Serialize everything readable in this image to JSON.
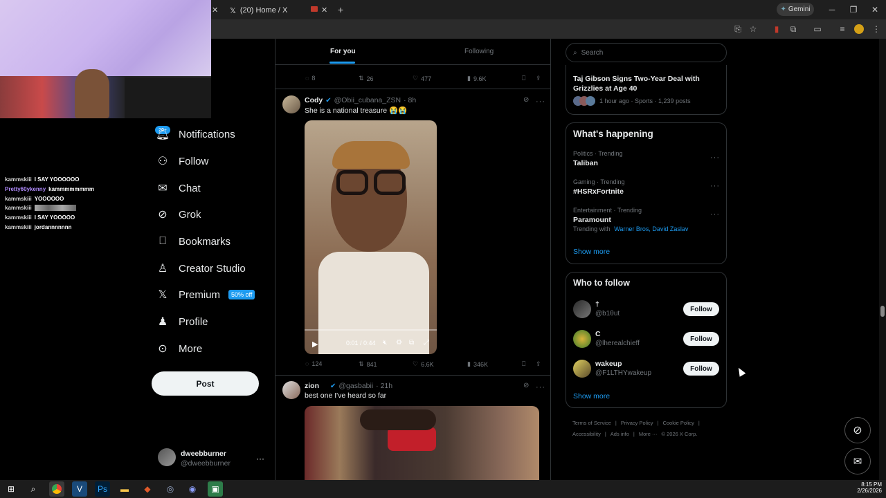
{
  "browser": {
    "tab_title": "(20) Home / X",
    "gemini_label": "Gemini",
    "close_glyph": "✕",
    "newtab_glyph": "+"
  },
  "chat": [
    {
      "user": "kammskiii",
      "msg": "I SAY YOOOOOO"
    },
    {
      "user": "Pretty60ykenny",
      "msg": "kammmmmmmm"
    },
    {
      "user": "kammskiii",
      "msg": "YOOOOOO"
    },
    {
      "user": "kammskiii",
      "msg": ""
    },
    {
      "user": "kammskiii",
      "msg": "I SAY YOOOOO"
    },
    {
      "user": "kammskiii",
      "msg": "jordannnnnnn"
    }
  ],
  "nav": {
    "badge": "20+",
    "items": [
      "Notifications",
      "Follow",
      "Chat",
      "Grok",
      "Bookmarks",
      "Creator Studio",
      "Premium",
      "Profile",
      "More"
    ],
    "premium_badge": "50% off",
    "post_label": "Post",
    "account_name": "dweebburner",
    "account_handle": "@dweebburner"
  },
  "feed": {
    "tabs": [
      "For you",
      "Following"
    ],
    "top_actions": {
      "replies": "8",
      "reposts": "26",
      "likes": "477",
      "views": "9.6K"
    },
    "post1": {
      "name": "Cody",
      "handle": "@Obii_cubana_ZSN",
      "time": "· 8h",
      "text": "She is a national treasure 😭😭",
      "video_time": "0:01 / 0:44",
      "replies": "124",
      "reposts": "841",
      "likes": "6.6K",
      "views": "346K"
    },
    "post2": {
      "name": "zion",
      "handle": "@gasbabii",
      "time": "· 21h",
      "text": "best one I've heard so far"
    }
  },
  "sidebar": {
    "search_placeholder": "Search",
    "news_title": "Taj Gibson Signs Two-Year Deal with Grizzlies at Age 40",
    "news_meta": "1 hour ago · Sports · 1,239 posts",
    "happening_title": "What's happening",
    "trends": [
      {
        "category": "Politics · Trending",
        "name": "Taliban"
      },
      {
        "category": "Gaming · Trending",
        "name": "#HSRxFortnite"
      },
      {
        "category": "Entertainment · Trending",
        "name": "Paramount",
        "with_label": "Trending with",
        "with_links": "Warner Bros, David Zaslav"
      }
    ],
    "show_more": "Show more",
    "wtf_title": "Who to follow",
    "follow_label": "Follow",
    "suggestions": [
      {
        "name": "†",
        "handle": "@b1θut"
      },
      {
        "name": "C",
        "handle": "@lherealchieff"
      },
      {
        "name": "wakeup",
        "handle": "@F1LTHYwakeup"
      }
    ],
    "footer": [
      "Terms of Service",
      "|",
      "Privacy Policy",
      "|",
      "Cookie Policy",
      "|",
      "Accessibility",
      "|",
      "Ads info",
      "|",
      "More ···",
      "© 2026 X Corp."
    ]
  },
  "taskbar": {
    "time": "8:15 PM",
    "date": "2/26/2026"
  },
  "colors": {
    "accent": "#1d9bf0",
    "premium_badge_bg": "#1d9bf0",
    "bg": "#000000",
    "border": "#2f3336"
  }
}
